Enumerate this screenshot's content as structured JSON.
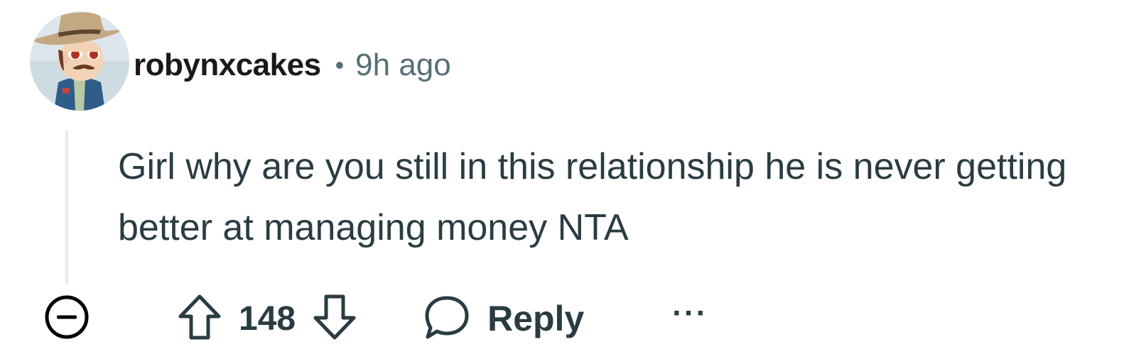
{
  "comment": {
    "author": "robynxcakes",
    "separator": "•",
    "time_ago": "9h ago",
    "body": "Girl why are you still in this relationship he is never getting better at managing money NTA",
    "score": "148",
    "reply_label": "Reply",
    "more_label": "···"
  },
  "icons": {
    "collapse": "collapse-minus-icon",
    "upvote": "upvote-arrow-icon",
    "downvote": "downvote-arrow-icon",
    "reply": "speech-bubble-icon",
    "more": "more-options-icon"
  },
  "colors": {
    "text": "#2a3c42",
    "meta": "#576f76",
    "thread_line": "#e5ebee"
  }
}
